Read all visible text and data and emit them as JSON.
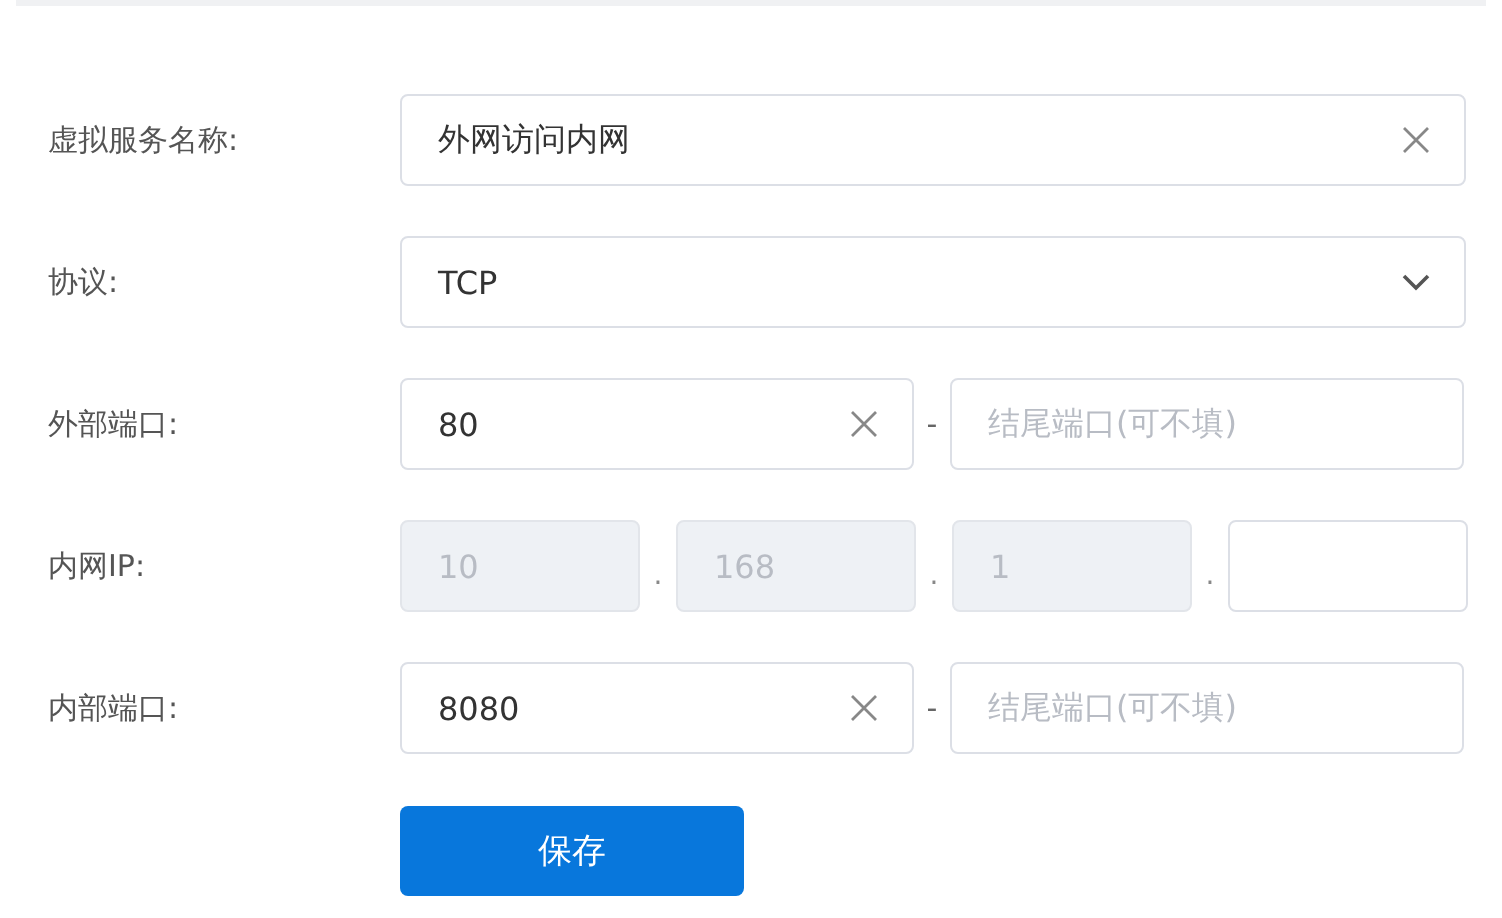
{
  "form": {
    "rows": [
      {
        "kind": "text",
        "label": "虚拟服务名称:",
        "value": "外网访问内网",
        "clearable": true
      },
      {
        "kind": "select",
        "label": "协议:",
        "value": "TCP"
      },
      {
        "kind": "port",
        "label": "外部端口:",
        "value": "80",
        "clearable": true,
        "separator": "-",
        "end_placeholder": "结尾端口(可不填)"
      },
      {
        "kind": "ip",
        "label": "内网IP:",
        "separator": ".",
        "parts": [
          {
            "value": "10",
            "disabled": true
          },
          {
            "value": "168",
            "disabled": true
          },
          {
            "value": "1",
            "disabled": true
          },
          {
            "disabled": false
          }
        ]
      },
      {
        "kind": "port",
        "label": "内部端口:",
        "value": "8080",
        "clearable": true,
        "separator": "-",
        "end_placeholder": "结尾端口(可不填)"
      }
    ],
    "save_button": "保存"
  }
}
